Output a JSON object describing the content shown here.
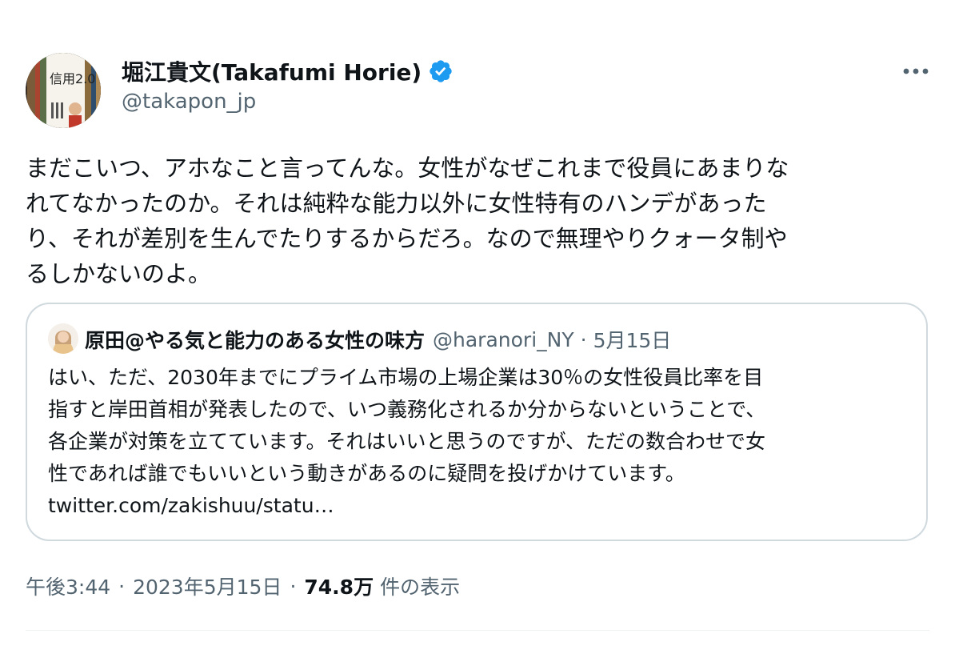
{
  "author": {
    "display_name": "堀江貴文(Takafumi Horie)",
    "handle": "@takapon_jp",
    "verified_icon": "verified-badge-icon",
    "avatar_book_title": "信用2.0"
  },
  "tweet": {
    "text_lines": [
      "まだこいつ、アホなこと言ってんな。女性がなぜこれまで役員にあまりな",
      "れてなかったのか。それは純粋な能力以外に女性特有のハンデがあった",
      "り、それが差別を生んでたりするからだろ。なので無理やりクォータ制や",
      "るしかないのよ。"
    ]
  },
  "quote": {
    "display_name": "原田@やる気と能力のある女性の味方",
    "handle": "@haranori_NY",
    "separator": "·",
    "date": "5月15日",
    "text_lines": [
      "はい、ただ、2030年までにプライム市場の上場企業は30％の女性役員比率を目",
      "指すと岸田首相が発表したので、いつ義務化されるか分からないということで、",
      "各企業が対策を立てています。それはいいと思うのですが、ただの数合わせで女",
      "性であれば誰でもいいという動きがあるのに疑問を投げかけています。",
      "twitter.com/zakishuu/statu…"
    ]
  },
  "meta": {
    "time": "午後3:44",
    "separator": "·",
    "date": "2023年5月15日",
    "views_count": "74.8万",
    "views_label": "件の表示"
  },
  "colors": {
    "text_primary": "#0f1419",
    "text_secondary": "#536471",
    "verified_blue": "#1d9bf0",
    "border": "#cfd9de"
  }
}
